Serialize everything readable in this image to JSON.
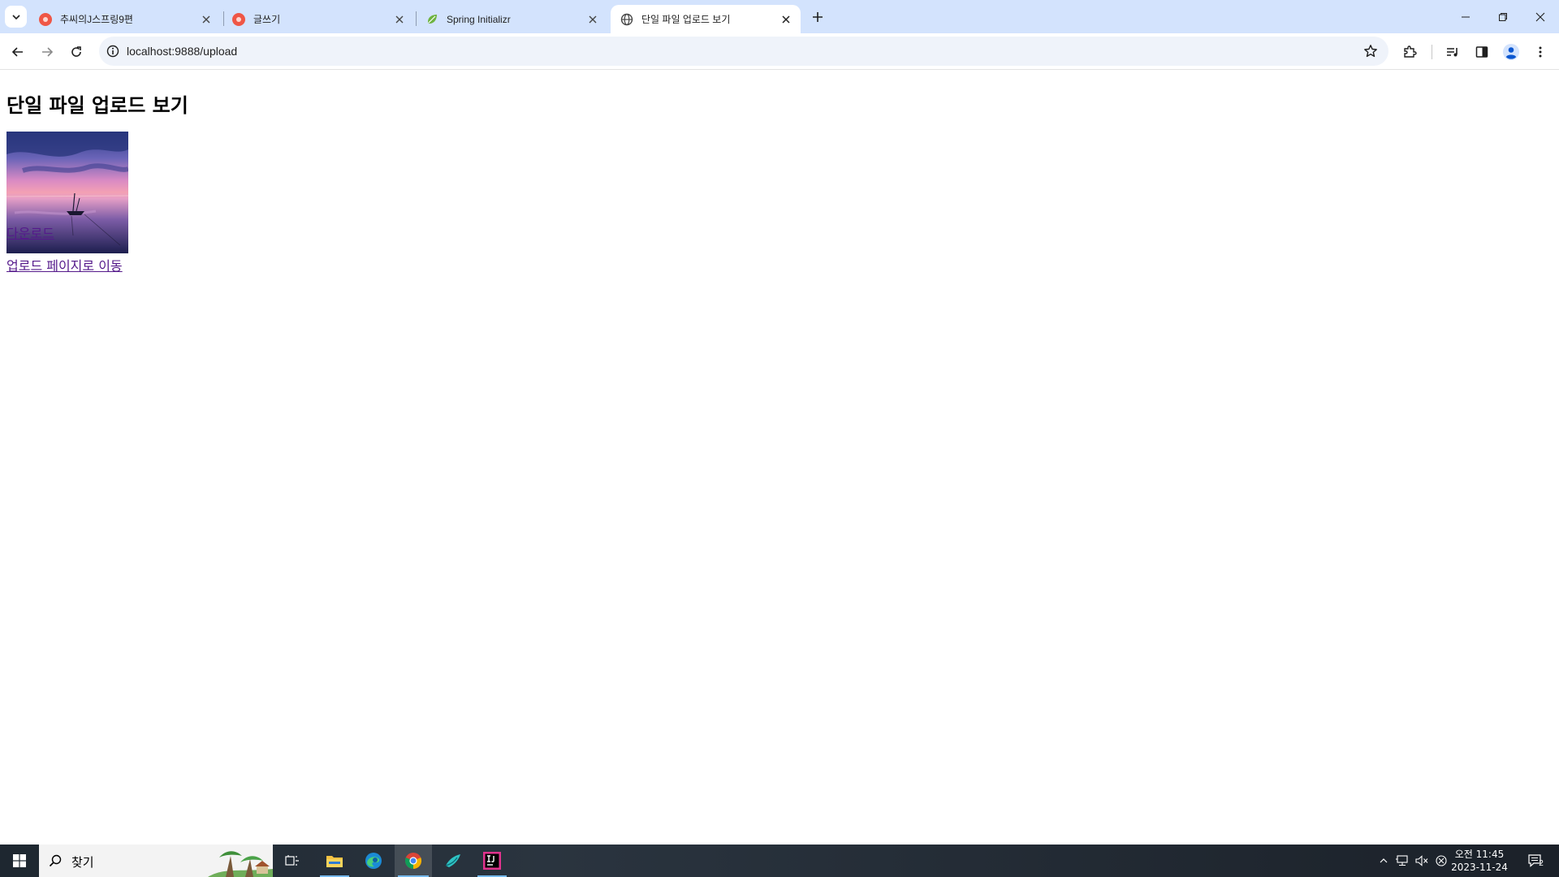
{
  "browser": {
    "tabs": [
      {
        "title": "추씨의J스프링9편",
        "favicon": "tistory-icon"
      },
      {
        "title": "글쓰기",
        "favicon": "tistory-icon"
      },
      {
        "title": "Spring Initializr",
        "favicon": "spring-icon"
      },
      {
        "title": "단일 파일 업로드 보기",
        "favicon": "globe-icon",
        "active": true
      }
    ],
    "url": "localhost:9888/upload"
  },
  "page": {
    "heading": "단일 파일 업로드 보기",
    "image": "sunset-boat-photo",
    "download_link": "다운로드",
    "upload_page_link": "업로드 페이지로 이동"
  },
  "taskbar": {
    "search_placeholder": "찾기",
    "clock_time": "오전 11:45",
    "clock_date": "2023-11-24",
    "notification_count": "2"
  },
  "colors": {
    "tabstrip_bg": "#d3e3fd",
    "omnibox_bg": "#eff3fa",
    "visited_link": "#551a8b",
    "taskbar_bg": "#202a33"
  }
}
